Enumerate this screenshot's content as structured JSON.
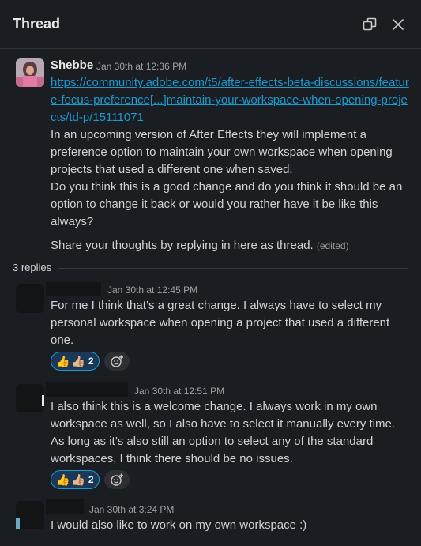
{
  "header": {
    "title": "Thread"
  },
  "parent": {
    "author": "Shebbe",
    "timestamp": "Jan 30th at 12:36 PM",
    "link": "https://community.adobe.com/t5/after-effects-beta-discussions/feature-focus-preference[...]maintain-your-workspace-when-opening-projects/td-p/15111071",
    "paragraph1": "In an upcoming version of After Effects they will implement a preference option to maintain your own workspace when opening projects that used a different one when saved.",
    "paragraph2": "Do you think this is a good change and do you think it should be an option to change it back or would you rather have it be like this always?",
    "paragraph3": "Share your thoughts by replying in here as thread.",
    "edited_label": "(edited)"
  },
  "replies_count": "3 replies",
  "replies": [
    {
      "timestamp": "Jan 30th at 12:45 PM",
      "text": "For me I think that’s a great change. I always have to select my personal workspace when opening a project that used a different one.",
      "reaction": {
        "emoji1": "👍",
        "emoji2": "👍🏼",
        "count": "2"
      }
    },
    {
      "timestamp": "Jan 30th at 12:51 PM",
      "text": "I also think this is a welcome change. I always work in my own workspace as well, so I also have to select it manually every time. As long as it’s also still an option to select any of the standard workspaces, I think there should be no issues.",
      "reaction": {
        "emoji1": "👍",
        "emoji2": "👍🏼",
        "count": "2"
      }
    },
    {
      "timestamp": "Jan 30th at 3:24 PM",
      "text": "I would also like to work on my own workspace :)"
    }
  ],
  "colors": {
    "background": "#1a1d21",
    "link": "#1d9bd1",
    "reaction_bg": "#1c3857",
    "reaction_border": "#1d9bd1"
  },
  "icons": {
    "pop_out": "pop-out-icon",
    "close": "close-icon",
    "add_reaction": "add-reaction-icon"
  }
}
